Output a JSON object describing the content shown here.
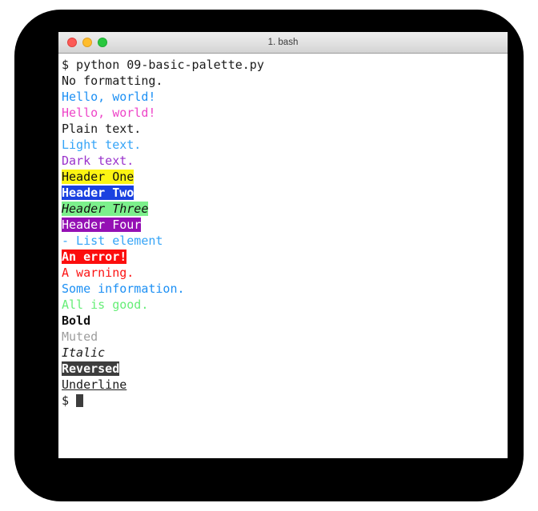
{
  "window": {
    "title": "1. bash",
    "traffic_lights": [
      {
        "name": "close",
        "color": "#fc5b57"
      },
      {
        "name": "minimize",
        "color": "#ffbd2d"
      },
      {
        "name": "maximize",
        "color": "#29c73f"
      }
    ]
  },
  "terminal": {
    "prompt_symbol": "$",
    "command": "python 09-basic-palette.py",
    "lines": [
      {
        "id": "cmd",
        "text": "$ python 09-basic-palette.py",
        "style": "st-plain"
      },
      {
        "id": "no-format",
        "text": "No formatting.",
        "style": "st-plain"
      },
      {
        "id": "hello-info",
        "text": "Hello, world!",
        "style": "st-info"
      },
      {
        "id": "hello-magenta",
        "text": "Hello, world!",
        "style": "st-magenta"
      },
      {
        "id": "plain-text",
        "text": "Plain text.",
        "style": "st-plain"
      },
      {
        "id": "light-text",
        "text": "Light text.",
        "style": "st-lightblue"
      },
      {
        "id": "dark-text",
        "text": "Dark text.",
        "style": "st-purple"
      },
      {
        "id": "header-one",
        "text": "Header One",
        "style": "st-h1"
      },
      {
        "id": "header-two",
        "text": "Header Two",
        "style": "st-h2"
      },
      {
        "id": "header-three",
        "text": "Header Three",
        "style": "st-h3"
      },
      {
        "id": "header-four",
        "text": "Header Four",
        "style": "st-h4"
      },
      {
        "id": "list-element",
        "text": "- List element",
        "style": "st-lightblue"
      },
      {
        "id": "error",
        "text": "An error!",
        "style": "st-err"
      },
      {
        "id": "warning",
        "text": "A warning.",
        "style": "st-error-txt"
      },
      {
        "id": "information",
        "text": "Some information.",
        "style": "st-info"
      },
      {
        "id": "success",
        "text": "All is good.",
        "style": "st-success"
      },
      {
        "id": "bold",
        "text": "Bold",
        "style": "st-bold"
      },
      {
        "id": "muted",
        "text": "Muted",
        "style": "st-muted"
      },
      {
        "id": "italic",
        "text": "Italic",
        "style": "st-italic"
      },
      {
        "id": "reversed",
        "text": "Reversed",
        "style": "st-rev"
      },
      {
        "id": "underline",
        "text": "Underline",
        "style": "st-underline"
      }
    ],
    "final_prompt": "$ "
  },
  "colors": {
    "frame": "#000000",
    "page_background": "#ffffff",
    "terminal_background": "#ffffff",
    "titlebar_text": "#3b3b3b",
    "default_text": "#1b1b1b",
    "info_blue": "#1d90f4",
    "magenta": "#ee45c8",
    "light_blue": "#35a4f7",
    "purple": "#9a33cc",
    "error_red": "#fc0d0d",
    "success_green": "#66ee77",
    "muted_gray": "#9d9d9d",
    "header_one_bg": "#fcf413",
    "header_two_bg": "#1a41e0",
    "header_three_bg": "#7cf08c",
    "header_four_bg": "#9410b4",
    "reversed_bg": "#3d3d3d",
    "cursor": "#3d3d3d"
  }
}
